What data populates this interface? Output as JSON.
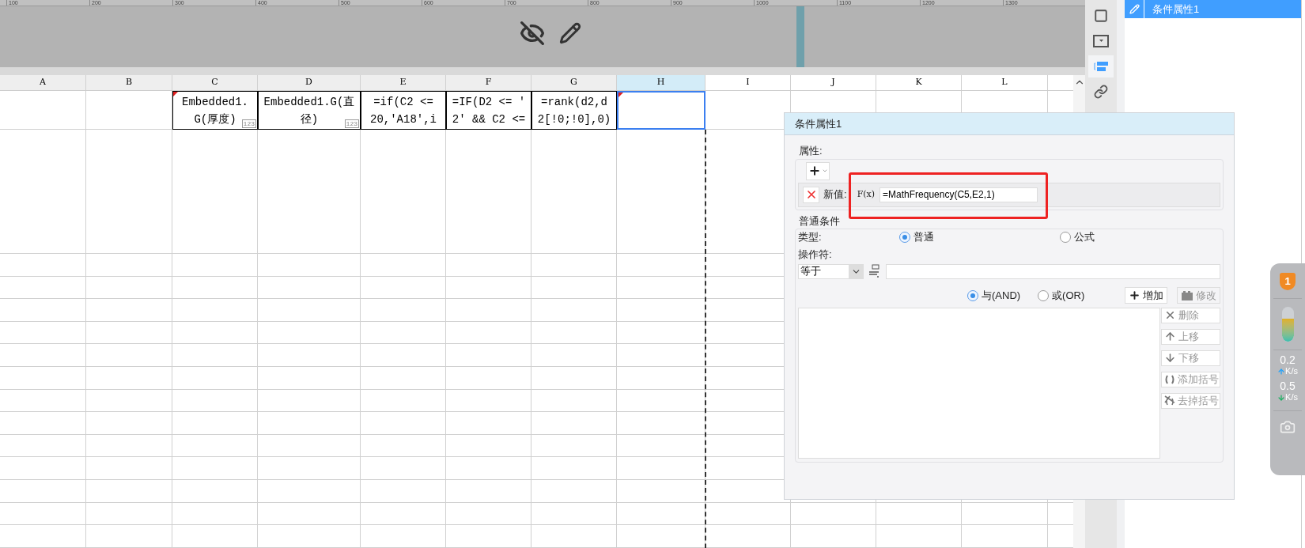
{
  "ruler": {
    "labels": [
      "100",
      "200",
      "300",
      "400",
      "500",
      "600",
      "700",
      "800",
      "900",
      "1000",
      "1100",
      "1200",
      "1300"
    ]
  },
  "sheet": {
    "columns": [
      {
        "label": "A",
        "selected": false
      },
      {
        "label": "B",
        "selected": false
      },
      {
        "label": "C",
        "selected": false
      },
      {
        "label": "D",
        "selected": false
      },
      {
        "label": "E",
        "selected": false
      },
      {
        "label": "F",
        "selected": false
      },
      {
        "label": "G",
        "selected": false
      },
      {
        "label": "H",
        "selected": true
      },
      {
        "label": "I",
        "selected": false
      },
      {
        "label": "J",
        "selected": false
      },
      {
        "label": "K",
        "selected": false
      },
      {
        "label": "L",
        "selected": false
      }
    ],
    "cells": [
      {
        "selected": false,
        "marked": false,
        "bordered": false
      },
      {
        "selected": false,
        "marked": false,
        "bordered": false
      },
      {
        "lines": [
          "Embedded1.",
          "G(厚度)"
        ],
        "badge": "123",
        "selected": false,
        "marked": true,
        "bordered": true
      },
      {
        "lines": [
          "Embedded1.G(直",
          "径)"
        ],
        "badge": "123",
        "selected": false,
        "marked": false,
        "bordered": true
      },
      {
        "lines": [
          "=if(C2 <=",
          "20,'A18',i"
        ],
        "selected": false,
        "marked": false,
        "bordered": true
      },
      {
        "lines": [
          "=IF(D2 <= '",
          "2' && C2 <="
        ],
        "selected": false,
        "marked": false,
        "bordered": true
      },
      {
        "lines": [
          "=rank(d2,d",
          "2[!0;!0],0)"
        ],
        "selected": false,
        "marked": false,
        "bordered": true
      },
      {
        "selected": true,
        "marked": true,
        "bordered": false
      },
      {
        "selected": false,
        "marked": false,
        "bordered": false
      },
      {
        "selected": false,
        "marked": false,
        "bordered": false
      },
      {
        "selected": false,
        "marked": false,
        "bordered": false
      },
      {
        "selected": false,
        "marked": false,
        "bordered": false
      }
    ]
  },
  "toolbar": {
    "items": [
      {
        "kind": "square",
        "selected": false
      },
      {
        "kind": "dropdown",
        "selected": false
      },
      {
        "kind": "bars",
        "selected": true
      },
      {
        "kind": "link",
        "selected": false
      }
    ]
  },
  "panel": {
    "items": [
      {
        "label": "条件属性1",
        "selected": true
      }
    ]
  },
  "dialog": {
    "title": "条件属性1",
    "attributes": {
      "legend": "属性:",
      "label": "新值:",
      "fx": "F(x)",
      "value": "=MathFrequency(C5,E2,1)",
      "highlighted": true
    },
    "condition": {
      "legend": "普通条件",
      "type_label": "类型:",
      "types": [
        {
          "label": "普通",
          "selected": true
        },
        {
          "label": "公式",
          "selected": false
        }
      ],
      "operator_label": "操作符:",
      "operator": "等于",
      "logic": [
        {
          "label": "与(AND)",
          "selected": true
        },
        {
          "label": "或(OR)",
          "selected": false
        }
      ],
      "buttons": [
        {
          "label": "增加",
          "kind": "plus",
          "disabled": false
        },
        {
          "label": "修改",
          "kind": "edit",
          "disabled": true
        }
      ],
      "side_buttons": [
        {
          "label": "删除",
          "kind": "x",
          "disabled": true
        },
        {
          "label": "上移",
          "kind": "up",
          "disabled": true
        },
        {
          "label": "下移",
          "kind": "down",
          "disabled": true
        },
        {
          "label": "添加括号",
          "kind": "paren",
          "disabled": true
        },
        {
          "label": "去掉括号",
          "kind": "unparen",
          "disabled": true
        }
      ]
    }
  },
  "monitor": {
    "badge": "1",
    "level": 0.65,
    "upload": {
      "value": "0.2",
      "unit": "K/s"
    },
    "download": {
      "value": "0.5",
      "unit": "K/s"
    }
  }
}
